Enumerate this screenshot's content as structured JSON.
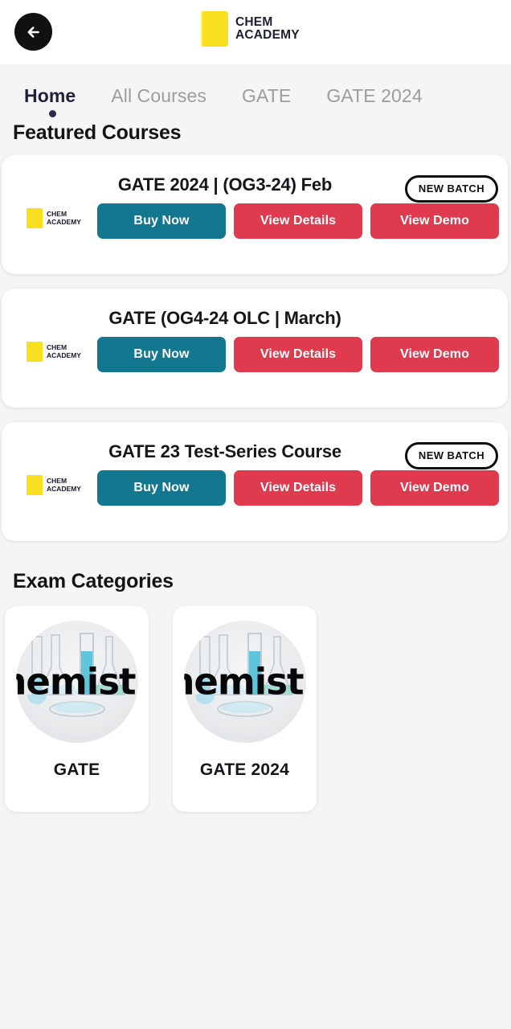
{
  "header": {
    "back_icon": "arrow-left-icon",
    "brand_mark_color": "#F8E01E",
    "brand_line1": "CHEM",
    "brand_line2": "ACADEMY"
  },
  "tabs": {
    "items": [
      {
        "label": "Home",
        "active": true
      },
      {
        "label": "All Courses",
        "active": false
      },
      {
        "label": "GATE",
        "active": false
      },
      {
        "label": "GATE 2024",
        "active": false
      }
    ],
    "active_color": "#1F2138",
    "inactive_color": "#9C9CA1"
  },
  "featured": {
    "heading": "Featured Courses",
    "buttons": {
      "buy": "Buy Now",
      "details": "View Details",
      "demo": "View Demo"
    },
    "badge_label": "NEW BATCH",
    "logo_line1": "CHEM",
    "logo_line2": "ACADEMY",
    "buy_color": "#13788F",
    "action_color": "#E03A4F",
    "courses": [
      {
        "title": "GATE 2024 | (OG3-24) Feb",
        "badge": "NEW BATCH"
      },
      {
        "title": "GATE (OG4-24 OLC | March)",
        "badge": ""
      },
      {
        "title": "GATE 23 Test-Series Course",
        "badge": "NEW BATCH"
      }
    ]
  },
  "categories": {
    "heading": "Exam Categories",
    "image_text": "hemistr",
    "items": [
      {
        "label": "GATE"
      },
      {
        "label": "GATE 2024"
      }
    ]
  }
}
